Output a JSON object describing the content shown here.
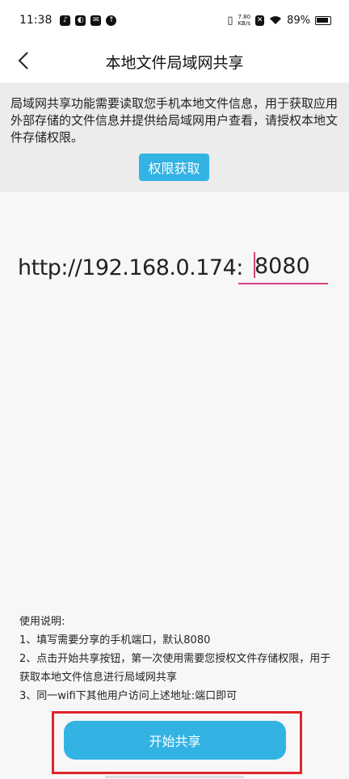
{
  "status_bar": {
    "time": "11:38",
    "speed_value": "7.80",
    "speed_unit": "KB/s",
    "battery": "89%"
  },
  "header": {
    "title": "本地文件局域网共享"
  },
  "permission": {
    "text": "局域网共享功能需要读取您手机本地文件信息，用于获取应用外部存储的文件信息并提供给局域网用户查看，请授权本地文件存储权限。",
    "button_label": "权限获取"
  },
  "share": {
    "url_prefix": "http://192.168.0.174:",
    "port": "8080"
  },
  "instructions": {
    "title": "使用说明:",
    "items": [
      "1、填写需要分享的手机端口，默认8080",
      "2、点击开始共享按钮，第一次使用需要您授权文件存储权限，用于获取本地文件信息进行局域网共享",
      "3、同一wifi下其他用户访问上述地址:端口即可"
    ]
  },
  "actions": {
    "start_label": "开始共享"
  },
  "colors": {
    "accent": "#33b3e4",
    "input_underline": "#d6417f",
    "highlight": "#e0262a"
  }
}
